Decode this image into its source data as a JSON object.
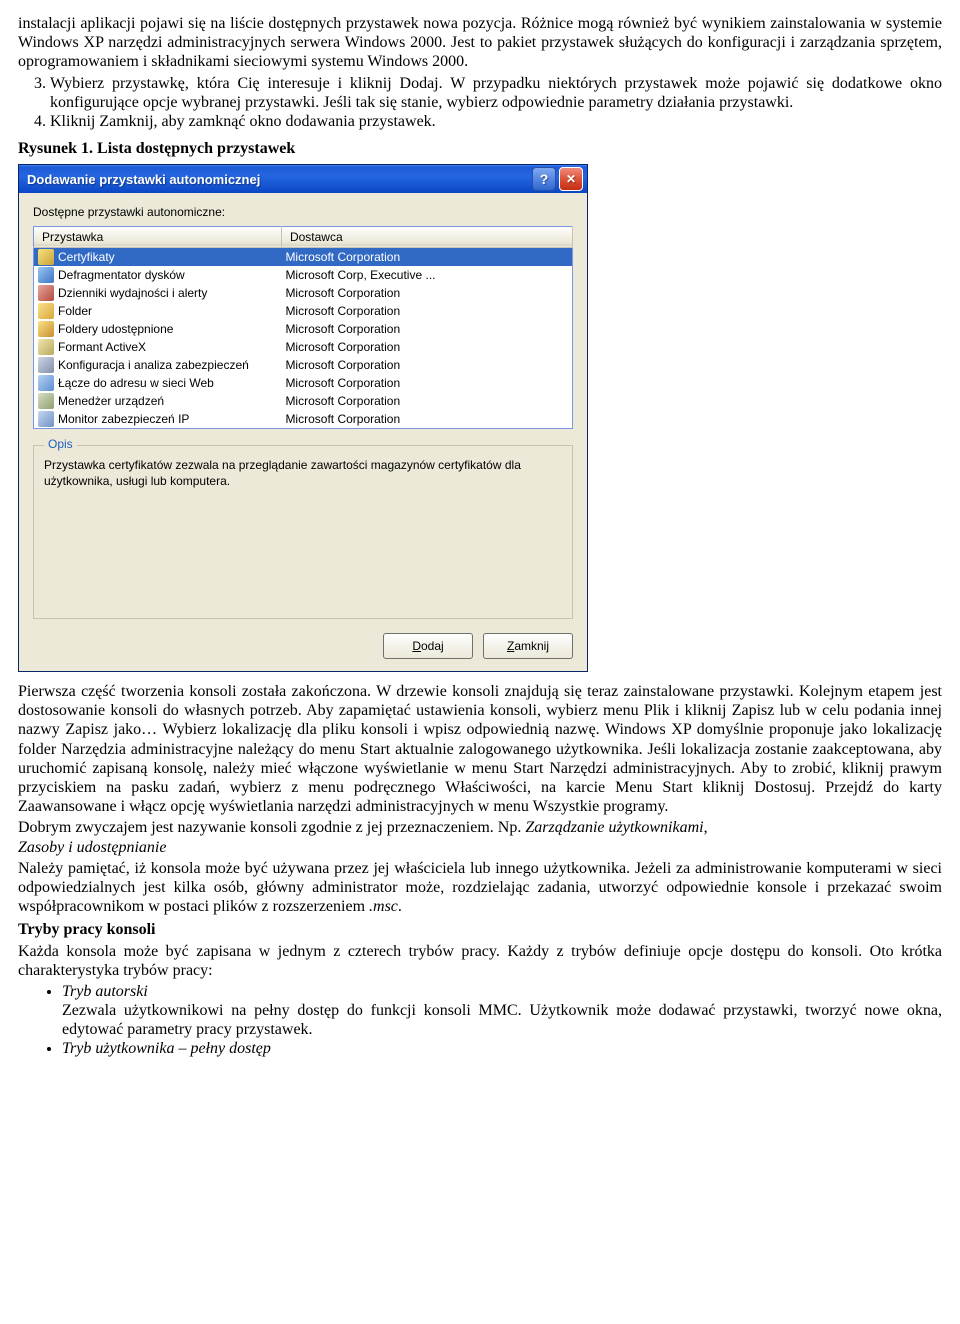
{
  "para1": "instalacji aplikacji pojawi się na liście dostępnych przystawek nowa pozycja. Różnice mogą również być wynikiem zainstalowania w systemie Windows XP narzędzi administracyjnych serwera Windows 2000. Jest to pakiet przystawek służących do konfiguracji i zarządzania sprzętem, oprogramowaniem i składnikami sieciowymi systemu Windows 2000.",
  "step3": "Wybierz przystawkę, która Cię interesuje i kliknij Dodaj. W przypadku niektórych przystawek może pojawić się dodatkowe okno konfigurujące opcje wybranej przystawki. Jeśli tak się stanie, wybierz odpowiednie parametry działania przystawki.",
  "step4": "Kliknij Zamknij, aby zamknąć okno dodawania przystawek.",
  "fig_caption": "Rysunek 1. Lista dostępnych przystawek",
  "dialog": {
    "title": "Dodawanie przystawki autonomicznej",
    "available_label": "Dostępne przystawki autonomiczne:",
    "col1": "Przystawka",
    "col2": "Dostawca",
    "rows": [
      {
        "name": "Certyfikaty",
        "vendor": "Microsoft Corporation",
        "selected": true,
        "icon": "linear-gradient(135deg,#f6e27a,#caa23a)"
      },
      {
        "name": "Defragmentator dysków",
        "vendor": "Microsoft Corp, Executive ...",
        "icon": "linear-gradient(135deg,#9cc7f2,#3d73c2)"
      },
      {
        "name": "Dzienniki wydajności i alerty",
        "vendor": "Microsoft Corporation",
        "icon": "linear-gradient(135deg,#e7a7a0,#b24a3c)"
      },
      {
        "name": "Folder",
        "vendor": "Microsoft Corporation",
        "icon": "linear-gradient(135deg,#fbe28a,#d9a63b)"
      },
      {
        "name": "Foldery udostępnione",
        "vendor": "Microsoft Corporation",
        "icon": "linear-gradient(135deg,#fbe28a,#c78f2e)"
      },
      {
        "name": "Formant ActiveX",
        "vendor": "Microsoft Corporation",
        "icon": "linear-gradient(135deg,#efe6b1,#b8a95b)"
      },
      {
        "name": "Konfiguracja i analiza zabezpieczeń",
        "vendor": "Microsoft Corporation",
        "icon": "linear-gradient(135deg,#cfd7e6,#7f8ea8)"
      },
      {
        "name": "Łącze do adresu w sieci Web",
        "vendor": "Microsoft Corporation",
        "icon": "linear-gradient(135deg,#b7d2f2,#5c8fd1)"
      },
      {
        "name": "Menedżer urządzeń",
        "vendor": "Microsoft Corporation",
        "icon": "linear-gradient(135deg,#d5ddc7,#8fa06e)"
      },
      {
        "name": "Monitor zabezpieczeń IP",
        "vendor": "Microsoft Corporation",
        "icon": "linear-gradient(135deg,#c7d7f0,#6f92c5)"
      }
    ],
    "desc_title": "Opis",
    "desc_text": "Przystawka certyfikatów zezwala na przeglądanie zawartości magazynów certyfikatów dla użytkownika, usługi lub komputera.",
    "btn_add_pre": "",
    "btn_add_ul": "D",
    "btn_add_post": "odaj",
    "btn_close_pre": "",
    "btn_close_ul": "Z",
    "btn_close_post": "amknij"
  },
  "para2": "Pierwsza część tworzenia konsoli została zakończona. W drzewie konsoli znajdują się teraz zainstalowane przystawki. Kolejnym etapem jest dostosowanie konsoli do własnych potrzeb. Aby zapamiętać ustawienia konsoli, wybierz menu Plik i kliknij Zapisz lub w celu podania innej nazwy Zapisz jako… Wybierz lokalizację dla pliku konsoli i wpisz odpowiednią nazwę. Windows XP domyślnie proponuje jako lokalizację folder Narzędzia administracyjne należący do menu Start aktualnie zalogowanego użytkownika. Jeśli lokalizacja zostanie zaakceptowana, aby  uruchomić zapisaną konsolę, należy mieć włączone wyświetlanie w menu Start Narzędzi administracyjnych. Aby to zrobić, kliknij prawym przyciskiem na pasku zadań, wybierz z menu podręcznego Właściwości, na karcie Menu Start kliknij Dostosuj. Przejdź do karty Zaawansowane i włącz opcję wyświetlania narzędzi administracyjnych w menu Wszystkie programy.",
  "para3a": "Dobrym zwyczajem jest nazywanie konsoli zgodnie z jej przeznaczeniem. Np. ",
  "para3b": "Zarządzanie użytkownikami",
  "para3c": ", ",
  "para3d": "Zasoby i udostępnianie",
  "para4a": "Należy pamiętać, iż konsola może być używana przez jej właściciela lub innego użytkownika. Jeżeli za administrowanie komputerami w sieci odpowiedzialnych jest kilka osób, główny administrator może, rozdzielając zadania, utworzyć odpowiednie konsole i przekazać swoim współpracownikom w postaci plików z rozszerzeniem ",
  "para4b": ".msc",
  "para4c": ".",
  "modes_head": "Tryby pracy konsoli",
  "modes_intro": "Każda konsola może być zapisana w jednym z czterech trybów pracy. Każdy z trybów definiuje opcje dostępu do konsoli. Oto krótka charakterystyka trybów pracy:",
  "mode1_name": "Tryb autorski",
  "mode1_desc": "Zezwala użytkownikowi na pełny dostęp do funkcji konsoli MMC. Użytkownik może dodawać przystawki, tworzyć nowe okna, edytować parametry pracy przystawek.",
  "mode2_name": "Tryb użytkownika – pełny dostęp"
}
